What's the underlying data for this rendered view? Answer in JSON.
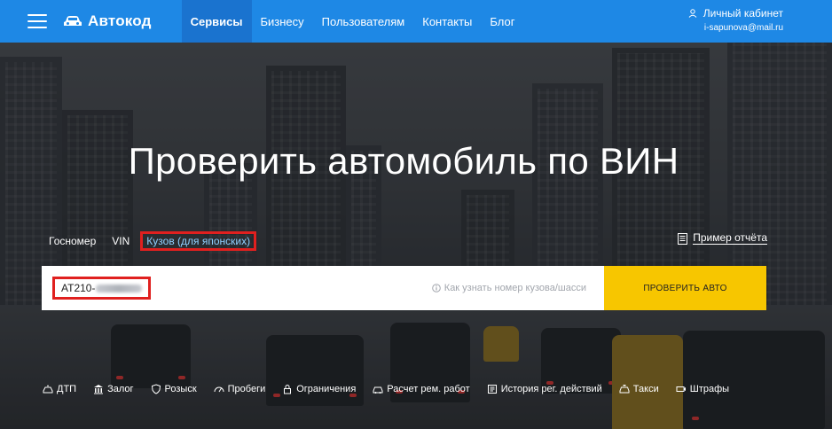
{
  "header": {
    "logo_text": "Автокод",
    "nav": [
      "Сервисы",
      "Бизнесу",
      "Пользователям",
      "Контакты",
      "Блог"
    ],
    "account_label": "Личный кабинет",
    "account_email": "i-sapunova@mail.ru"
  },
  "hero": {
    "title": "Проверить автомобиль по ВИН",
    "tabs": [
      "Госномер",
      "VIN",
      "Кузов (для японских)"
    ],
    "active_tab": "Кузов (для японских)",
    "sample_report": "Пример отчёта",
    "input_value": "AT210-",
    "input_hint": "Как узнать номер кузова/шасси",
    "check_button": "ПРОВЕРИТЬ АВТО"
  },
  "features": [
    {
      "label": "ДТП",
      "icon": "crash-icon"
    },
    {
      "label": "Залог",
      "icon": "bank-icon"
    },
    {
      "label": "Розыск",
      "icon": "shield-icon"
    },
    {
      "label": "Пробеги",
      "icon": "speedometer-icon"
    },
    {
      "label": "Ограничения",
      "icon": "lock-icon"
    },
    {
      "label": "Расчет рем. работ",
      "icon": "car-repair-icon"
    },
    {
      "label": "История рег. действий",
      "icon": "history-icon"
    },
    {
      "label": "Такси",
      "icon": "taxi-icon"
    },
    {
      "label": "Штрафы",
      "icon": "camera-icon"
    }
  ],
  "colors": {
    "header": "#1e88e5",
    "button": "#f7c600",
    "highlight": "#e0201f"
  }
}
